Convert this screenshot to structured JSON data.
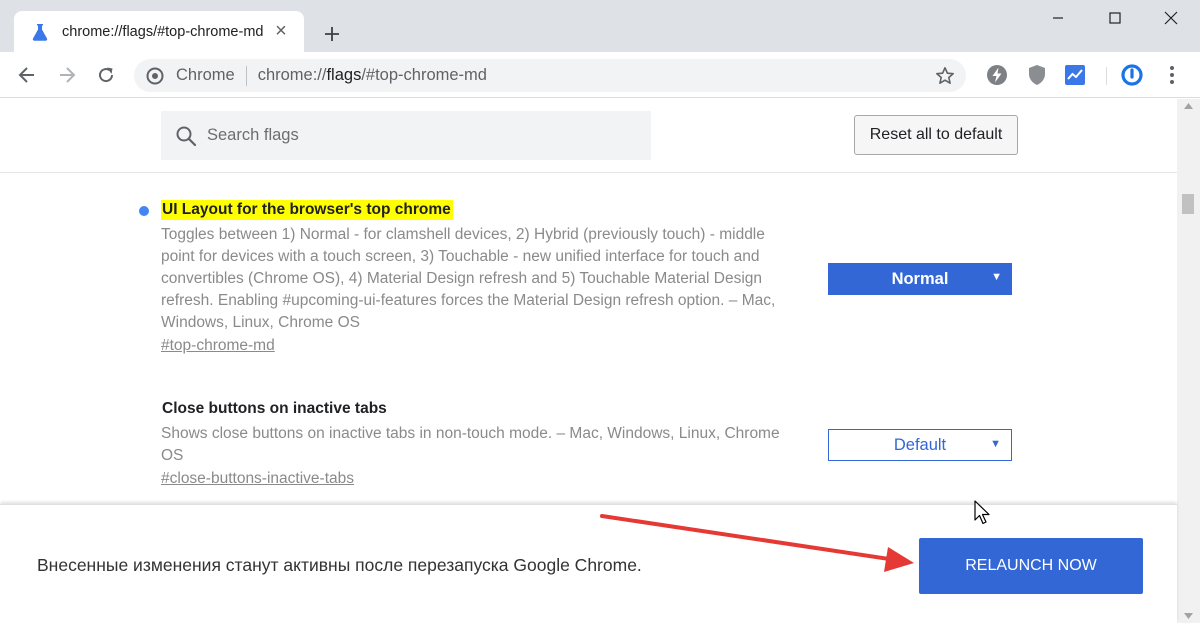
{
  "tab": {
    "title": "chrome://flags/#top-chrome-md",
    "close_glyph": "×",
    "icon": "flask-icon",
    "new_tab_glyph": "+"
  },
  "window_controls": [
    "minimize-icon",
    "maximize-icon",
    "close-icon"
  ],
  "toolbar": {
    "site_chip": "Chrome",
    "url_prefix": "chrome://",
    "url_host": "flags",
    "url_rest": "/#top-chrome-md",
    "extensions": [
      "lightning-icon",
      "shield-icon",
      "chart-extension-icon",
      "power-ring-icon"
    ],
    "menu_icon": "kebab-menu-icon"
  },
  "search": {
    "placeholder": "Search flags"
  },
  "reset_button": "Reset all to default",
  "flags": [
    {
      "title": "UI Layout for the browser's top chrome",
      "highlighted": true,
      "description": "Toggles between 1) Normal - for clamshell devices, 2) Hybrid (previously touch) - middle point for devices with a touch screen, 3) Touchable - new unified interface for touch and convertibles (Chrome OS), 4) Material Design refresh and 5) Touchable Material Design refresh. Enabling #upcoming-ui-features forces the Material Design refresh option. – Mac, Windows, Linux, Chrome OS",
      "link": "#top-chrome-md",
      "selected": "Normal",
      "select_style": "filled"
    },
    {
      "title": "Close buttons on inactive tabs",
      "highlighted": false,
      "description": "Shows close buttons on inactive tabs in non-touch mode. – Mac, Windows, Linux, Chrome OS",
      "link": "#close-buttons-inactive-tabs",
      "selected": "Default",
      "select_style": "outline"
    }
  ],
  "caret_glyph": "▼",
  "relaunch": {
    "message": "Внесенные изменения станут активны после перезапуска Google Chrome.",
    "button": "RELAUNCH NOW"
  },
  "colors": {
    "accent_blue": "#3367d6",
    "highlight_yellow": "#ffff00",
    "annotation_arrow": "#e53935",
    "modified_dot": "#4285f4"
  }
}
